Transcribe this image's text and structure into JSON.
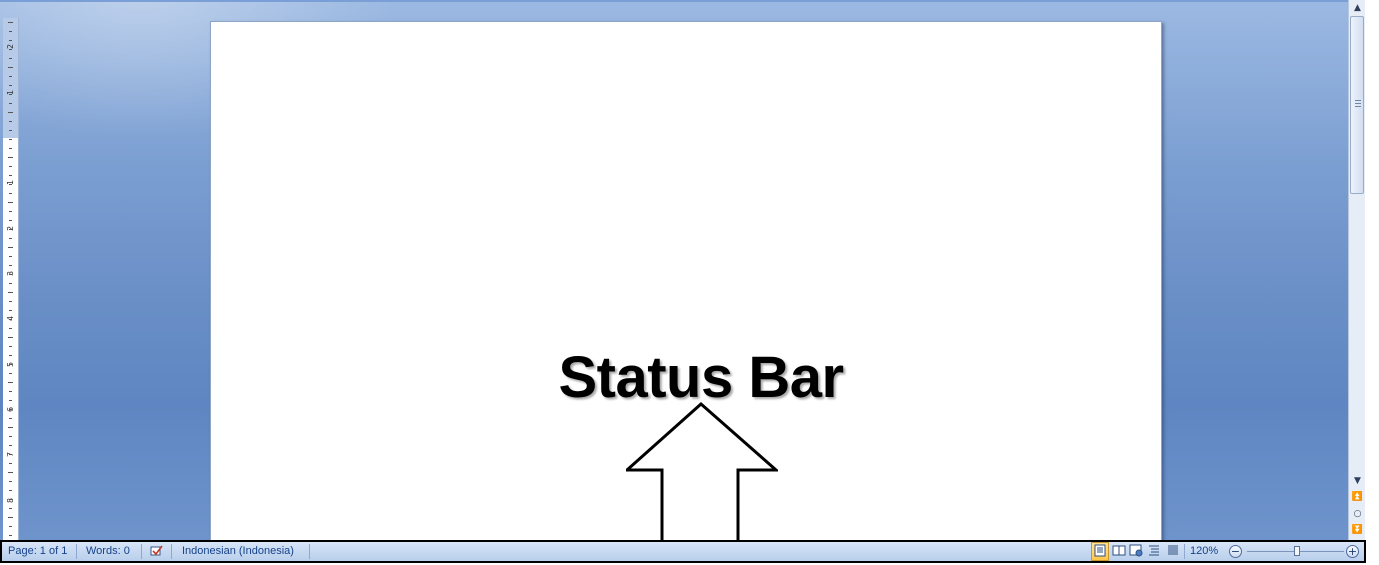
{
  "document": {
    "heading": "Status Bar",
    "arrow_icon": "up-arrow-icon"
  },
  "vertical_ruler": {
    "labels": [
      "2",
      "1",
      "1",
      "2",
      "3",
      "4",
      "5",
      "6",
      "7",
      "8"
    ]
  },
  "status_bar": {
    "page": "Page: 1 of 1",
    "words": "Words: 0",
    "proofing_icon": "spelling-check-icon",
    "language": "Indonesian (Indonesia)",
    "views": [
      "print-layout-icon",
      "full-screen-reading-icon",
      "web-layout-icon",
      "outline-icon",
      "draft-icon"
    ],
    "zoom_label": "120%",
    "zoom_percent": 120,
    "zoom_out": "−",
    "zoom_in": "+"
  },
  "scrollbar": {
    "up": "▲",
    "down": "▼",
    "prev_page": "⏫",
    "browse_object": "○",
    "next_page": "⏬"
  },
  "colors": {
    "workspace": "#6a8fc7",
    "status_bar": "#c7d9f1",
    "status_text": "#15428b",
    "active_view": "#ffc549"
  }
}
